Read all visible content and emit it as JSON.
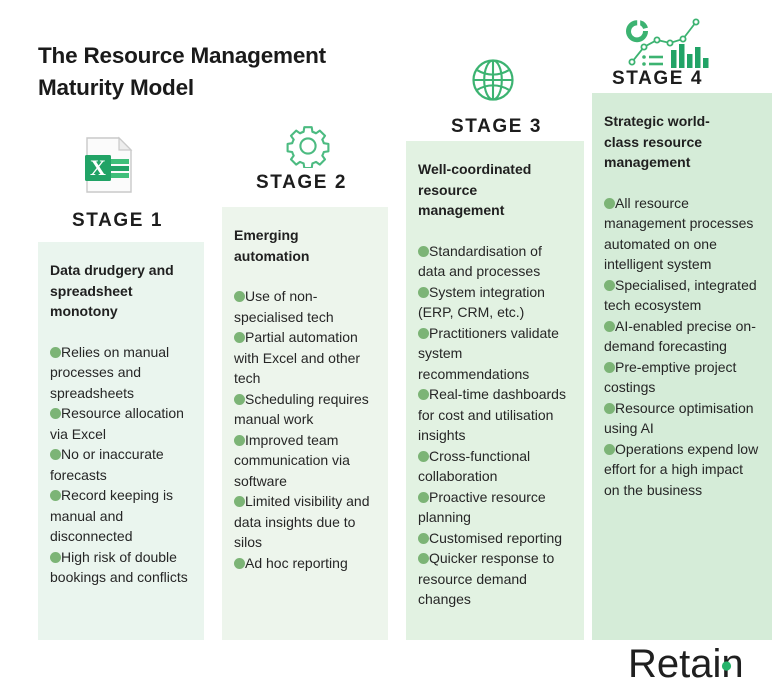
{
  "title": "The Resource Management\nMaturity Model",
  "colors": {
    "panel_stage1": "#eaf5ee",
    "panel_stage2": "#edf5ec",
    "panel_stage3": "#e2f2e2",
    "panel_stage4": "#d5ecd8",
    "bullet_dot": "#7cb476",
    "icon_green": "#3cb371",
    "excel_green": "#21a366",
    "logo_dark": "#1f1f1f",
    "logo_accent": "#25b36b",
    "text_dark": "#1d1d1d"
  },
  "stages": [
    {
      "id": "stage-1",
      "label": "STAGE 1",
      "icon": "excel-file-icon",
      "heading": "Data drudgery and\nspreadsheet\nmonotony",
      "bullets": [
        "Relies on manual processes and spreadsheets",
        "Resource allocation via Excel",
        "No or inaccurate forecasts",
        "Record keeping is manual and disconnected",
        "High risk of double bookings and conflicts"
      ]
    },
    {
      "id": "stage-2",
      "label": "STAGE 2",
      "icon": "gear-icon",
      "heading": "Emerging\nautomation",
      "bullets": [
        "Use of non-specialised tech",
        "Partial automation with Excel and other tech",
        "Scheduling requires manual work",
        "Improved team communication via software",
        "Limited visibility and data insights due to silos",
        "Ad hoc reporting"
      ]
    },
    {
      "id": "stage-3",
      "label": "STAGE 3",
      "icon": "globe-icon",
      "heading": "Well-coordinated\nresource\nmanagement",
      "bullets": [
        "Standardisation of data and processes",
        "System integration (ERP, CRM, etc.)",
        "Practitioners validate system recommendations",
        "Real-time dashboards for cost and utilisation insights",
        "Cross-functional collaboration",
        "Proactive resource planning",
        "Customised reporting",
        "Quicker response to resource demand changes"
      ]
    },
    {
      "id": "stage-4",
      "label": "STAGE 4",
      "icon": "analytics-dashboard-icon",
      "heading": "Strategic world-\nclass resource\nmanagement",
      "bullets": [
        "All resource management processes automated on one intelligent system",
        "Specialised, integrated tech ecosystem",
        "AI-enabled precise on-demand forecasting",
        "Pre-emptive project costings",
        "Resource optimisation using AI",
        "Operations expend low effort for a high impact on the business"
      ]
    }
  ],
  "logo": {
    "name": "Retain",
    "text": "Retain"
  }
}
